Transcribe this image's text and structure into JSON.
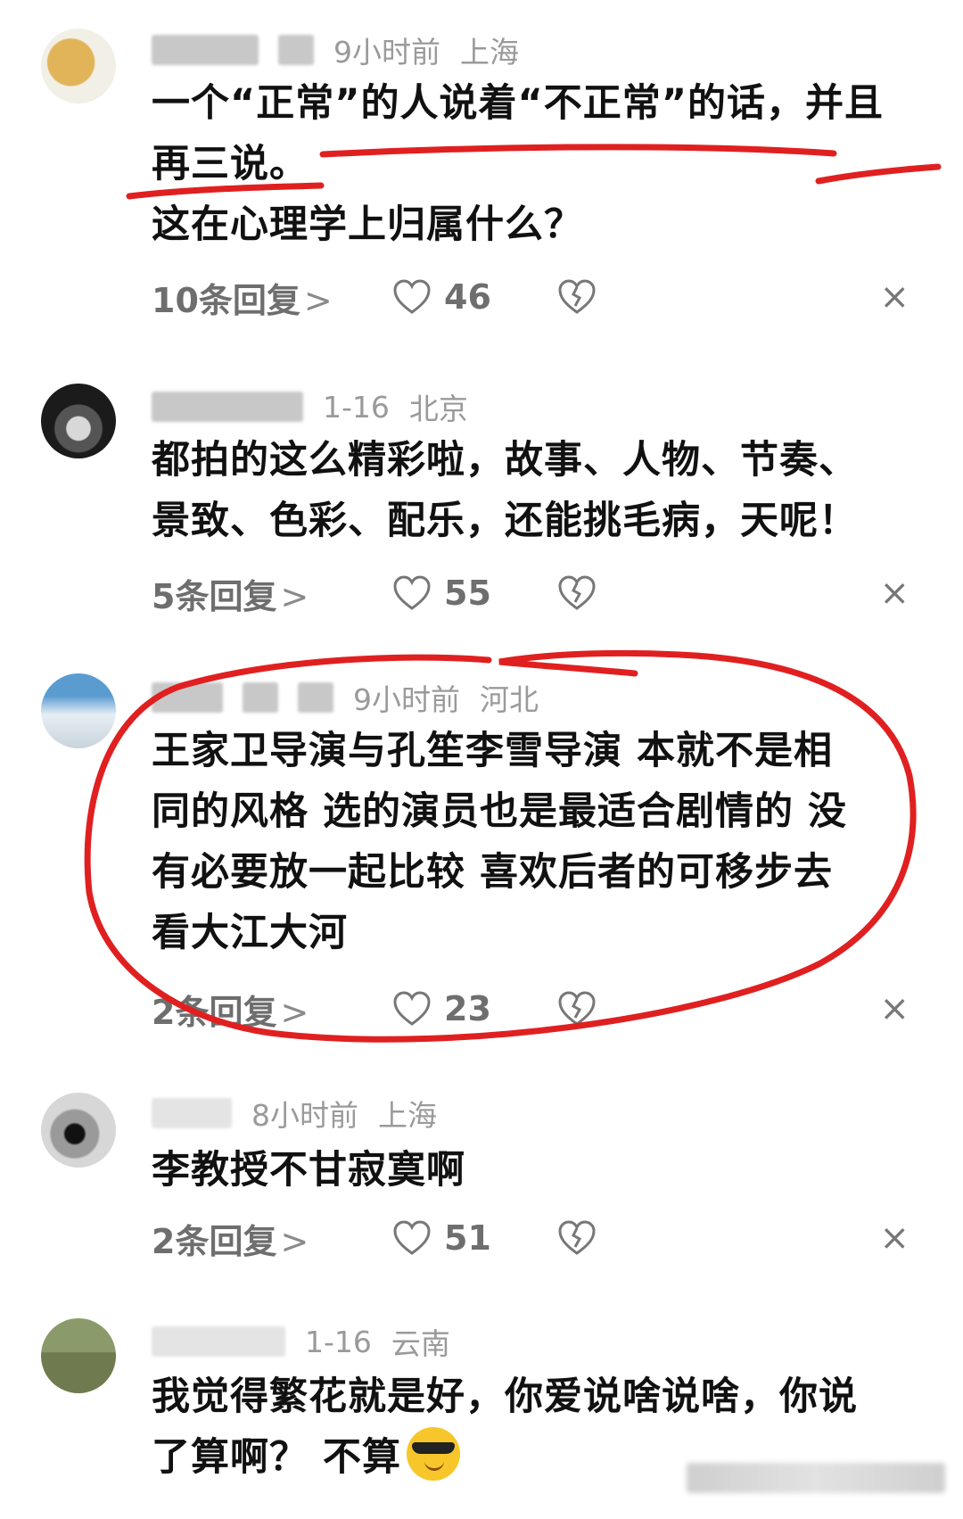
{
  "comments": [
    {
      "time": "9小时前",
      "location": "上海",
      "text_lines": [
        "一个“正常”的人说着“不正常”的话，并且",
        "再三说。",
        "这在心理学上归属什么？"
      ],
      "replies": "10条回复",
      "likes": "46"
    },
    {
      "time": "1-16",
      "location": "北京",
      "text_lines": [
        "都拍的这么精彩啦，故事、人物、节奏、",
        "景致、色彩、配乐，还能挑毛病，天呢！"
      ],
      "replies": "5条回复",
      "likes": "55"
    },
    {
      "time": "9小时前",
      "location": "河北",
      "text_lines": [
        "王家卫导演与孔笙李雪导演 本就不是相",
        "同的风格 选的演员也是最适合剧情的 没",
        "有必要放一起比较 喜欢后者的可移步去",
        "看大江大河"
      ],
      "replies": "2条回复",
      "likes": "23"
    },
    {
      "time": "8小时前",
      "location": "上海",
      "text_lines": [
        "李教授不甘寂寞啊"
      ],
      "replies": "2条回复",
      "likes": "51"
    },
    {
      "time": "1-16",
      "location": "云南",
      "text_lines": [
        "我觉得繁花就是好，你爱说啥说啥，你说",
        "了算啊？ 不算"
      ]
    }
  ],
  "icons": {
    "reply_chevron": ">",
    "close": "×",
    "like": "heart-outline-icon",
    "dislike": "broken-heart-icon",
    "emoji": "sunglasses-emoji"
  },
  "colors": {
    "annotation": "#e02020",
    "meta": "#9a9a9a",
    "text": "#111111"
  }
}
